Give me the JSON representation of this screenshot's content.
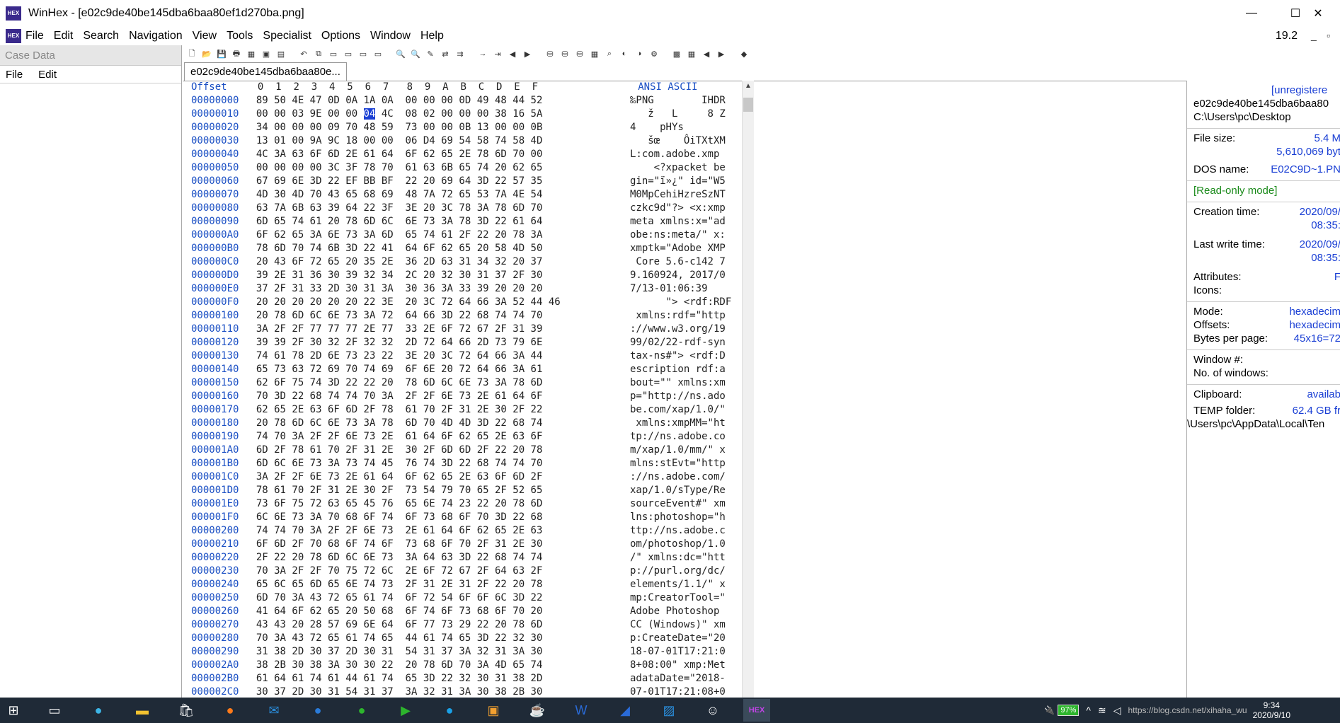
{
  "window": {
    "title": "WinHex - [e02c9de40be145dba6baa80ef1d270ba.png]",
    "minimize": "—",
    "maximize": "☐",
    "close": "✕"
  },
  "menu": [
    "File",
    "Edit",
    "Search",
    "Navigation",
    "View",
    "Tools",
    "Specialist",
    "Options",
    "Window",
    "Help"
  ],
  "zoom": "19.2",
  "left_pane": {
    "title": "Case Data",
    "menu": [
      "File",
      "Edit"
    ]
  },
  "tab": {
    "label": "e02c9de40be145dba6baa80e..."
  },
  "hex_header": {
    "offset": "Offset",
    "cols": " 0  1  2  3  4  5  6  7   8  9  A  B  C  D  E  F",
    "ansi": "ANSI ASCII"
  },
  "hex_rows": [
    {
      "off": "00000000",
      "hex": "89 50 4E 47 0D 0A 1A 0A  00 00 00 0D 49 48 44 52",
      "asc": "‰PNG        IHDR"
    },
    {
      "off": "00000010",
      "hex": "00 00 03 9E 00 00 04 4C  08 02 00 00 00 38 16 5A",
      "asc": "   ž   L     8 Z"
    },
    {
      "off": "00000020",
      "hex": "34 00 00 00 09 70 48 59  73 00 00 0B 13 00 00 0B",
      "asc": "4    pHYs       "
    },
    {
      "off": "00000030",
      "hex": "13 01 00 9A 9C 18 00 00  06 D4 69 54 58 74 58 4D",
      "asc": "   šœ    ÔiTXtXM"
    },
    {
      "off": "00000040",
      "hex": "4C 3A 63 6F 6D 2E 61 64  6F 62 65 2E 78 6D 70 00",
      "asc": "L:com.adobe.xmp "
    },
    {
      "off": "00000050",
      "hex": "00 00 00 00 3C 3F 78 70  61 63 6B 65 74 20 62 65",
      "asc": "    <?xpacket be"
    },
    {
      "off": "00000060",
      "hex": "67 69 6E 3D 22 EF BB BF  22 20 69 64 3D 22 57 35",
      "asc": "gin=\"ï»¿\" id=\"W5"
    },
    {
      "off": "00000070",
      "hex": "4D 30 4D 70 43 65 68 69  48 7A 72 65 53 7A 4E 54",
      "asc": "M0MpCehiHzreSzNT"
    },
    {
      "off": "00000080",
      "hex": "63 7A 6B 63 39 64 22 3F  3E 20 3C 78 3A 78 6D 70",
      "asc": "czkc9d\"?> <x:xmp"
    },
    {
      "off": "00000090",
      "hex": "6D 65 74 61 20 78 6D 6C  6E 73 3A 78 3D 22 61 64",
      "asc": "meta xmlns:x=\"ad"
    },
    {
      "off": "000000A0",
      "hex": "6F 62 65 3A 6E 73 3A 6D  65 74 61 2F 22 20 78 3A",
      "asc": "obe:ns:meta/\" x:"
    },
    {
      "off": "000000B0",
      "hex": "78 6D 70 74 6B 3D 22 41  64 6F 62 65 20 58 4D 50",
      "asc": "xmptk=\"Adobe XMP"
    },
    {
      "off": "000000C0",
      "hex": "20 43 6F 72 65 20 35 2E  36 2D 63 31 34 32 20 37",
      "asc": " Core 5.6-c142 7"
    },
    {
      "off": "000000D0",
      "hex": "39 2E 31 36 30 39 32 34  2C 20 32 30 31 37 2F 30",
      "asc": "9.160924, 2017/0"
    },
    {
      "off": "000000E0",
      "hex": "37 2F 31 33 2D 30 31 3A  30 36 3A 33 39 20 20 20",
      "asc": "7/13-01:06:39   "
    },
    {
      "off": "000000F0",
      "hex": "20 20 20 20 20 20 22 3E  20 3C 72 64 66 3A 52 44 46",
      "asc": "      \"> <rdf:RDF"
    },
    {
      "off": "00000100",
      "hex": "20 78 6D 6C 6E 73 3A 72  64 66 3D 22 68 74 74 70",
      "asc": " xmlns:rdf=\"http"
    },
    {
      "off": "00000110",
      "hex": "3A 2F 2F 77 77 77 2E 77  33 2E 6F 72 67 2F 31 39",
      "asc": "://www.w3.org/19"
    },
    {
      "off": "00000120",
      "hex": "39 39 2F 30 32 2F 32 32  2D 72 64 66 2D 73 79 6E",
      "asc": "99/02/22-rdf-syn"
    },
    {
      "off": "00000130",
      "hex": "74 61 78 2D 6E 73 23 22  3E 20 3C 72 64 66 3A 44",
      "asc": "tax-ns#\"> <rdf:D"
    },
    {
      "off": "00000140",
      "hex": "65 73 63 72 69 70 74 69  6F 6E 20 72 64 66 3A 61",
      "asc": "escription rdf:a"
    },
    {
      "off": "00000150",
      "hex": "62 6F 75 74 3D 22 22 20  78 6D 6C 6E 73 3A 78 6D",
      "asc": "bout=\"\" xmlns:xm"
    },
    {
      "off": "00000160",
      "hex": "70 3D 22 68 74 74 70 3A  2F 2F 6E 73 2E 61 64 6F",
      "asc": "p=\"http://ns.ado"
    },
    {
      "off": "00000170",
      "hex": "62 65 2E 63 6F 6D 2F 78  61 70 2F 31 2E 30 2F 22",
      "asc": "be.com/xap/1.0/\""
    },
    {
      "off": "00000180",
      "hex": "20 78 6D 6C 6E 73 3A 78  6D 70 4D 4D 3D 22 68 74",
      "asc": " xmlns:xmpMM=\"ht"
    },
    {
      "off": "00000190",
      "hex": "74 70 3A 2F 2F 6E 73 2E  61 64 6F 62 65 2E 63 6F",
      "asc": "tp://ns.adobe.co"
    },
    {
      "off": "000001A0",
      "hex": "6D 2F 78 61 70 2F 31 2E  30 2F 6D 6D 2F 22 20 78",
      "asc": "m/xap/1.0/mm/\" x"
    },
    {
      "off": "000001B0",
      "hex": "6D 6C 6E 73 3A 73 74 45  76 74 3D 22 68 74 74 70",
      "asc": "mlns:stEvt=\"http"
    },
    {
      "off": "000001C0",
      "hex": "3A 2F 2F 6E 73 2E 61 64  6F 62 65 2E 63 6F 6D 2F",
      "asc": "://ns.adobe.com/"
    },
    {
      "off": "000001D0",
      "hex": "78 61 70 2F 31 2E 30 2F  73 54 79 70 65 2F 52 65",
      "asc": "xap/1.0/sType/Re"
    },
    {
      "off": "000001E0",
      "hex": "73 6F 75 72 63 65 45 76  65 6E 74 23 22 20 78 6D",
      "asc": "sourceEvent#\" xm"
    },
    {
      "off": "000001F0",
      "hex": "6C 6E 73 3A 70 68 6F 74  6F 73 68 6F 70 3D 22 68",
      "asc": "lns:photoshop=\"h"
    },
    {
      "off": "00000200",
      "hex": "74 74 70 3A 2F 2F 6E 73  2E 61 64 6F 62 65 2E 63",
      "asc": "ttp://ns.adobe.c"
    },
    {
      "off": "00000210",
      "hex": "6F 6D 2F 70 68 6F 74 6F  73 68 6F 70 2F 31 2E 30",
      "asc": "om/photoshop/1.0"
    },
    {
      "off": "00000220",
      "hex": "2F 22 20 78 6D 6C 6E 73  3A 64 63 3D 22 68 74 74",
      "asc": "/\" xmlns:dc=\"htt"
    },
    {
      "off": "00000230",
      "hex": "70 3A 2F 2F 70 75 72 6C  2E 6F 72 67 2F 64 63 2F",
      "asc": "p://purl.org/dc/"
    },
    {
      "off": "00000240",
      "hex": "65 6C 65 6D 65 6E 74 73  2F 31 2E 31 2F 22 20 78",
      "asc": "elements/1.1/\" x"
    },
    {
      "off": "00000250",
      "hex": "6D 70 3A 43 72 65 61 74  6F 72 54 6F 6F 6C 3D 22",
      "asc": "mp:CreatorTool=\""
    },
    {
      "off": "00000260",
      "hex": "41 64 6F 62 65 20 50 68  6F 74 6F 73 68 6F 70 20",
      "asc": "Adobe Photoshop "
    },
    {
      "off": "00000270",
      "hex": "43 43 20 28 57 69 6E 64  6F 77 73 29 22 20 78 6D",
      "asc": "CC (Windows)\" xm"
    },
    {
      "off": "00000280",
      "hex": "70 3A 43 72 65 61 74 65  44 61 74 65 3D 22 32 30",
      "asc": "p:CreateDate=\"20"
    },
    {
      "off": "00000290",
      "hex": "31 38 2D 30 37 2D 30 31  54 31 37 3A 32 31 3A 30",
      "asc": "18-07-01T17:21:0"
    },
    {
      "off": "000002A0",
      "hex": "38 2B 30 38 3A 30 30 22  20 78 6D 70 3A 4D 65 74",
      "asc": "8+08:00\" xmp:Met"
    },
    {
      "off": "000002B0",
      "hex": "61 64 61 74 61 44 61 74  65 3D 22 32 30 31 38 2D",
      "asc": "adataDate=\"2018-"
    },
    {
      "off": "000002C0",
      "hex": "30 37 2D 30 31 54 31 37  3A 32 31 3A 30 38 2B 30",
      "asc": "07-01T17:21:08+0"
    }
  ],
  "info": {
    "unregistered": "[unregistere",
    "filename": "e02c9de40be145dba6baa80",
    "path": "C:\\Users\\pc\\Desktop",
    "file_size_label": "File size:",
    "file_size_short": "5.4 M",
    "file_size_bytes": "5,610,069 byt",
    "dos_name_label": "DOS name:",
    "dos_name": "E02C9D~1.PN",
    "readonly": "[Read-only mode]",
    "creation_label": "Creation time:",
    "creation_date": "2020/09/",
    "creation_time": "08:35:",
    "lastwrite_label": "Last write time:",
    "lastwrite_date": "2020/09/",
    "lastwrite_time": "08:35:",
    "attributes_label": "Attributes:",
    "attributes_val": "F",
    "icons_label": "Icons:",
    "mode_label": "Mode:",
    "mode_val": "hexadecim",
    "offsets_label": "Offsets:",
    "offsets_val": "hexadecim",
    "bpp_label": "Bytes per page:",
    "bpp_val": "45x16=72",
    "window_label": "Window #:",
    "nwin_label": "No. of windows:",
    "clipboard_label": "Clipboard:",
    "clipboard_val": "availab",
    "temp_label": "TEMP folder:",
    "temp_val": "62.4 GB fr",
    "temp_path": "\\Users\\pc\\AppData\\Local\\Ten"
  },
  "taskbar": {
    "battery": "97%",
    "time": "9:34",
    "date": "2020/9/10",
    "watermark": "https://blog.csdn.net/xihaha_wu"
  }
}
